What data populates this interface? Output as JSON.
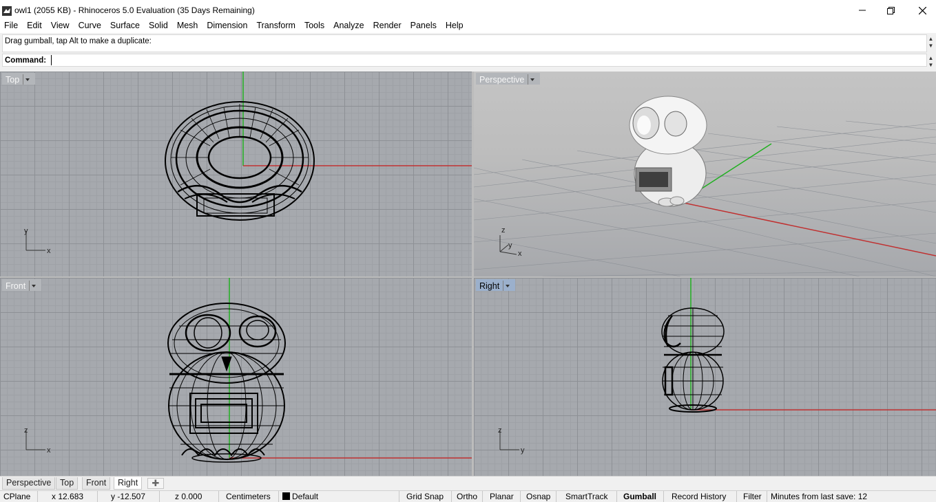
{
  "window": {
    "title": "owl1 (2055 KB) - Rhinoceros 5.0 Evaluation (35 Days Remaining)",
    "icons": [
      "rhino-app-icon",
      "minimize-icon",
      "restore-icon",
      "close-icon"
    ]
  },
  "menu": [
    "File",
    "Edit",
    "View",
    "Curve",
    "Surface",
    "Solid",
    "Mesh",
    "Dimension",
    "Transform",
    "Tools",
    "Analyze",
    "Render",
    "Panels",
    "Help"
  ],
  "command": {
    "history": "Drag gumball, tap Alt to make a duplicate:",
    "label": "Command:",
    "value": ""
  },
  "viewports": {
    "top": {
      "label": "Top",
      "axes": [
        "y",
        "x"
      ]
    },
    "perspective": {
      "label": "Perspective",
      "axes": [
        "z",
        "y",
        "x"
      ]
    },
    "front": {
      "label": "Front",
      "axes": [
        "z",
        "x"
      ]
    },
    "right": {
      "label": "Right",
      "axes": [
        "z",
        "y"
      ],
      "active": true
    }
  },
  "tabs": [
    "Perspective",
    "Top",
    "Front",
    "Right"
  ],
  "active_tab": "Right",
  "status": {
    "cplane": "CPlane",
    "x": "x 12.683",
    "y": "y -12.507",
    "z": "z 0.000",
    "units": "Centimeters",
    "layer": "Default",
    "toggles": [
      "Grid Snap",
      "Ortho",
      "Planar",
      "Osnap",
      "SmartTrack",
      "Gumball",
      "Record History",
      "Filter"
    ],
    "active_toggle": "Gumball",
    "save_info": "Minutes from last save: 12"
  },
  "colors": {
    "x_axis": "#c03030",
    "y_axis": "#20b020",
    "viewport_bg": "#a6a9ae",
    "active_label": "#9bb0cc"
  }
}
